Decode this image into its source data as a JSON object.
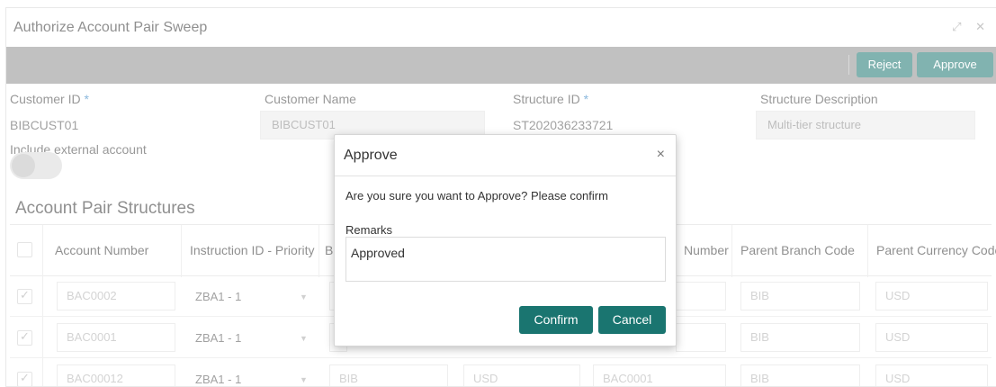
{
  "window": {
    "title": "Authorize Account Pair Sweep",
    "controls": "⤢ ✕"
  },
  "toolbar": {
    "reject_label": "Reject",
    "approve_label": "Approve"
  },
  "form": {
    "customer_id_label": "Customer ID",
    "customer_id_value": "BIBCUST01",
    "customer_name_label": "Customer Name",
    "customer_name_value": "BIBCUST01",
    "structure_id_label": "Structure ID",
    "structure_id_value": "ST202036233721",
    "structure_desc_label": "Structure Description",
    "structure_desc_value": "Multi-tier structure",
    "include_external_label": "Include external account",
    "include_external_on": false,
    "required_mark": "*"
  },
  "section_title": "Account Pair Structures",
  "table": {
    "headers": {
      "account_number": "Account Number",
      "instruction": "Instruction ID - Priority",
      "b": "B",
      "parent_account": "Number",
      "parent_branch": "Parent Branch Code",
      "parent_currency": "Parent Currency Code"
    },
    "rows": [
      {
        "checked": true,
        "account": "BAC0002",
        "instruction": "ZBA1 - 1",
        "branch": "",
        "currency": "",
        "parent_account": "",
        "parent_branch": "BIB",
        "parent_currency": "USD"
      },
      {
        "checked": true,
        "account": "BAC0001",
        "instruction": "ZBA1 - 1",
        "branch": "",
        "currency": "",
        "parent_account": "",
        "parent_branch": "BIB",
        "parent_currency": "USD"
      },
      {
        "checked": true,
        "account": "BAC00012",
        "instruction": "ZBA1 - 1",
        "branch": "BIB",
        "currency": "USD",
        "parent_account": "BAC0001",
        "parent_branch": "BIB",
        "parent_currency": "USD"
      }
    ]
  },
  "modal": {
    "title": "Approve",
    "close_glyph": "×",
    "message": "Are you sure you want to Approve? Please confirm",
    "remarks_label": "Remarks",
    "remarks_value": "Approved",
    "confirm_label": "Confirm",
    "cancel_label": "Cancel"
  },
  "colors": {
    "accent": "#1a7570",
    "toolbar": "#8f8f8f",
    "required": "#2b7ec1"
  }
}
